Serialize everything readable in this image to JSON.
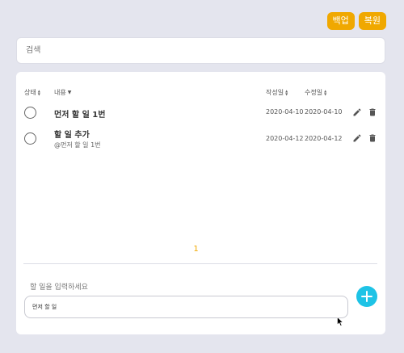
{
  "toolbar": {
    "backup_label": "백업",
    "restore_label": "복원"
  },
  "search": {
    "placeholder": "검색"
  },
  "table": {
    "headers": {
      "status": "상태",
      "content": "내용",
      "created": "작성일",
      "modified": "수정일"
    },
    "rows": [
      {
        "title": "먼저 할 일 1번",
        "subtitle": "",
        "created": "2020-04-10",
        "modified": "2020-04-10"
      },
      {
        "title": "할 일 추가",
        "subtitle": "@먼저 할 일 1번",
        "created": "2020-04-12",
        "modified": "2020-04-12"
      }
    ]
  },
  "pagination": {
    "current": "1"
  },
  "new_todo": {
    "label": "할 일을 입력하세요",
    "value": "먼저 할 일"
  },
  "colors": {
    "accent": "#f0a800",
    "fab": "#1ec3e6",
    "background": "#e4e5ee"
  },
  "icons": {
    "edit": "pencil-icon",
    "delete": "trash-icon",
    "add": "plus-icon",
    "sort": "sort-icon"
  }
}
